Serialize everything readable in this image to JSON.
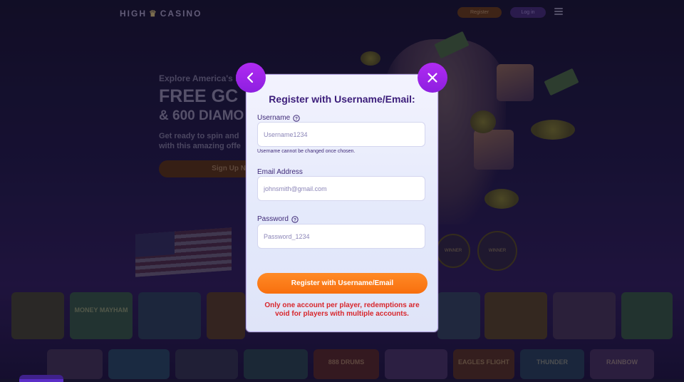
{
  "site": {
    "logo_left": "HIGH",
    "logo_right": "CASINO",
    "header_buttons": [
      "Register",
      "Log in"
    ]
  },
  "hero": {
    "kicker": "Explore America's l",
    "headline": "FREE GC",
    "subheadline": "& 600 DIAMO",
    "body_line1": "Get ready to spin and",
    "body_line2": "with this amazing offe",
    "cta": "Sign Up Now"
  },
  "badges": [
    "WINNER",
    "WINNER"
  ],
  "games_row1": [
    "",
    "MONEY MAYHAM",
    "",
    "",
    "",
    "",
    "",
    "",
    "",
    ""
  ],
  "games_row2": [
    "",
    "",
    "",
    "",
    "888 DRUMS",
    "",
    "EAGLES FLIGHT",
    "THUNDER",
    "RAINBOW"
  ],
  "modal": {
    "title": "Register with Username/Email:",
    "back_icon": "chevron-left-icon",
    "close_icon": "close-icon",
    "username": {
      "label": "Username",
      "placeholder": "Username1234",
      "hint": "Username cannot be changed once chosen."
    },
    "email": {
      "label": "Email Address",
      "placeholder": "johnsmith@gmail.com"
    },
    "password": {
      "label": "Password",
      "placeholder": "Password_1234"
    },
    "submit_label": "Register with Username/Email",
    "warning": "Only one account per player, redemptions are void for players with multiple accounts."
  },
  "colors": {
    "accent_purple": "#9b24e8",
    "accent_orange": "#fa7a18",
    "title_purple": "#3b1d7a",
    "warning_red": "#d8262c"
  }
}
